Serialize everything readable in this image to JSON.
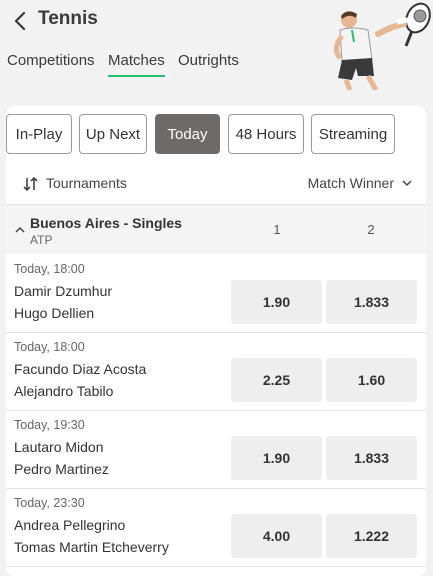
{
  "header": {
    "title": "Tennis",
    "tabs": [
      {
        "label": "Competitions",
        "active": false
      },
      {
        "label": "Matches",
        "active": true
      },
      {
        "label": "Outrights",
        "active": false
      }
    ]
  },
  "filters": [
    {
      "label": "In-Play",
      "active": false
    },
    {
      "label": "Up Next",
      "active": false
    },
    {
      "label": "Today",
      "active": true
    },
    {
      "label": "48 Hours",
      "active": false
    },
    {
      "label": "Streaming",
      "active": false
    }
  ],
  "toolbar": {
    "tournaments_label": "Tournaments",
    "market_label": "Match Winner"
  },
  "competition": {
    "name": "Buenos Aires - Singles",
    "tour": "ATP",
    "col1": "1",
    "col2": "2"
  },
  "matches": [
    {
      "time": "Today, 18:00",
      "home": "Damir Dzumhur",
      "away": "Hugo Dellien",
      "odd1": "1.90",
      "odd2": "1.833"
    },
    {
      "time": "Today, 18:00",
      "home": "Facundo Diaz Acosta",
      "away": "Alejandro Tabilo",
      "odd1": "2.25",
      "odd2": "1.60"
    },
    {
      "time": "Today, 19:30",
      "home": "Lautaro Midon",
      "away": "Pedro Martinez",
      "odd1": "1.90",
      "odd2": "1.833"
    },
    {
      "time": "Today, 23:30",
      "home": "Andrea Pellegrino",
      "away": "Tomas Martin Etcheverry",
      "odd1": "4.00",
      "odd2": "1.222"
    }
  ],
  "colors": {
    "accent": "#25c26e",
    "chip_active": "#6e6a6a"
  }
}
